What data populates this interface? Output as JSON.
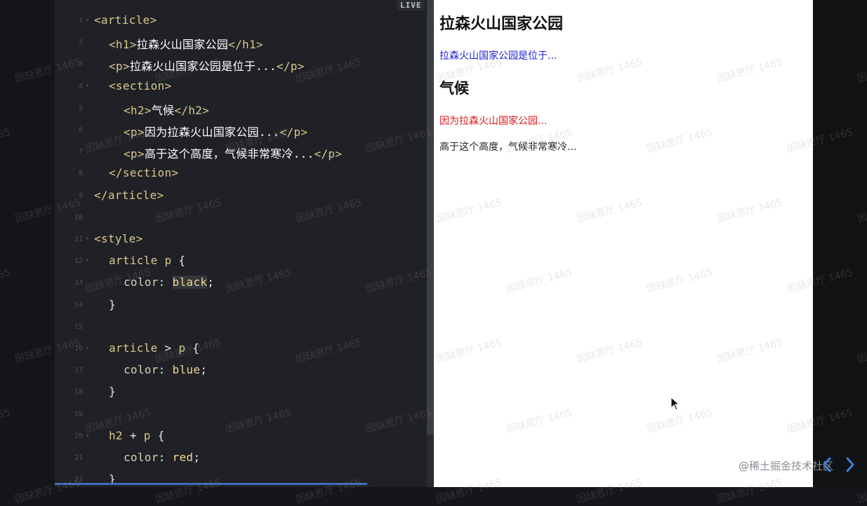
{
  "editor": {
    "live_label": "LIVE",
    "lines": [
      {
        "n": "1",
        "fold": true,
        "indent": 0,
        "tokens": [
          {
            "t": "<article>",
            "c": "tag"
          }
        ]
      },
      {
        "n": "2",
        "fold": false,
        "indent": 1,
        "tokens": [
          {
            "t": "<h1>",
            "c": "tag"
          },
          {
            "t": "拉森火山国家公园",
            "c": "txt"
          },
          {
            "t": "</h1>",
            "c": "tag"
          }
        ]
      },
      {
        "n": "3",
        "fold": false,
        "indent": 1,
        "tokens": [
          {
            "t": "<p>",
            "c": "tag"
          },
          {
            "t": "拉森火山国家公园是位于...",
            "c": "txt"
          },
          {
            "t": "</p>",
            "c": "tag"
          }
        ]
      },
      {
        "n": "4",
        "fold": true,
        "indent": 1,
        "tokens": [
          {
            "t": "<section>",
            "c": "tag"
          }
        ]
      },
      {
        "n": "5",
        "fold": false,
        "indent": 2,
        "tokens": [
          {
            "t": "<h2>",
            "c": "tag"
          },
          {
            "t": "气候",
            "c": "txt"
          },
          {
            "t": "</h2>",
            "c": "tag"
          }
        ]
      },
      {
        "n": "6",
        "fold": false,
        "indent": 2,
        "tokens": [
          {
            "t": "<p>",
            "c": "tag"
          },
          {
            "t": "因为拉森火山国家公园...",
            "c": "txt"
          },
          {
            "t": "</p>",
            "c": "tag"
          }
        ]
      },
      {
        "n": "7",
        "fold": false,
        "indent": 2,
        "tokens": [
          {
            "t": "<p>",
            "c": "tag"
          },
          {
            "t": "高于这个高度，气候非常寒冷...",
            "c": "txt"
          },
          {
            "t": "</p>",
            "c": "tag"
          }
        ]
      },
      {
        "n": "8",
        "fold": false,
        "indent": 1,
        "tokens": [
          {
            "t": "</section>",
            "c": "tag"
          }
        ]
      },
      {
        "n": "9",
        "fold": false,
        "indent": 0,
        "tokens": [
          {
            "t": "</article>",
            "c": "tag"
          }
        ]
      },
      {
        "n": "10",
        "fold": false,
        "indent": 0,
        "tokens": []
      },
      {
        "n": "11",
        "fold": true,
        "indent": 0,
        "tokens": [
          {
            "t": "<style>",
            "c": "tag"
          }
        ]
      },
      {
        "n": "12",
        "fold": true,
        "indent": 1,
        "tokens": [
          {
            "t": "article p ",
            "c": "sel"
          },
          {
            "t": "{",
            "c": "punc"
          }
        ]
      },
      {
        "n": "13",
        "fold": false,
        "indent": 2,
        "tokens": [
          {
            "t": "color",
            "c": "prop"
          },
          {
            "t": ": ",
            "c": "punc"
          },
          {
            "t": "black",
            "c": "val hl"
          },
          {
            "t": ";",
            "c": "punc"
          }
        ]
      },
      {
        "n": "14",
        "fold": false,
        "indent": 1,
        "tokens": [
          {
            "t": "}",
            "c": "punc"
          }
        ]
      },
      {
        "n": "15",
        "fold": false,
        "indent": 0,
        "tokens": []
      },
      {
        "n": "16",
        "fold": true,
        "indent": 1,
        "tokens": [
          {
            "t": "article ",
            "c": "sel"
          },
          {
            "t": "> ",
            "c": "punc"
          },
          {
            "t": "p ",
            "c": "sel"
          },
          {
            "t": "{",
            "c": "punc"
          }
        ]
      },
      {
        "n": "17",
        "fold": false,
        "indent": 2,
        "tokens": [
          {
            "t": "color",
            "c": "prop"
          },
          {
            "t": ": ",
            "c": "punc"
          },
          {
            "t": "blue",
            "c": "val"
          },
          {
            "t": ";",
            "c": "punc"
          }
        ]
      },
      {
        "n": "18",
        "fold": false,
        "indent": 1,
        "tokens": [
          {
            "t": "}",
            "c": "punc"
          }
        ]
      },
      {
        "n": "19",
        "fold": false,
        "indent": 0,
        "tokens": []
      },
      {
        "n": "20",
        "fold": true,
        "indent": 1,
        "tokens": [
          {
            "t": "h2 ",
            "c": "sel"
          },
          {
            "t": "+ ",
            "c": "punc"
          },
          {
            "t": "p ",
            "c": "sel"
          },
          {
            "t": "{",
            "c": "punc"
          }
        ]
      },
      {
        "n": "21",
        "fold": false,
        "indent": 2,
        "tokens": [
          {
            "t": "color",
            "c": "prop"
          },
          {
            "t": ": ",
            "c": "punc"
          },
          {
            "t": "red",
            "c": "val"
          },
          {
            "t": ";",
            "c": "punc"
          }
        ]
      },
      {
        "n": "22",
        "fold": false,
        "indent": 1,
        "tokens": [
          {
            "t": "}",
            "c": "punc"
          }
        ]
      }
    ]
  },
  "preview": {
    "h1": "拉森火山国家公园",
    "p1": "拉森火山国家公园是位于...",
    "h2": "气候",
    "p2": "因为拉森火山国家公园...",
    "p3": "高于这个高度，气候非常寒冷...",
    "colors": {
      "p1": "#2020d8",
      "p2": "#e01818",
      "p3": "#222222"
    }
  },
  "footer": {
    "credit": "@稀土掘金技术社区",
    "prev_icon": "chevron-left-icon",
    "next_icon": "chevron-right-icon"
  },
  "watermark_text": "因缺思厅 1465"
}
